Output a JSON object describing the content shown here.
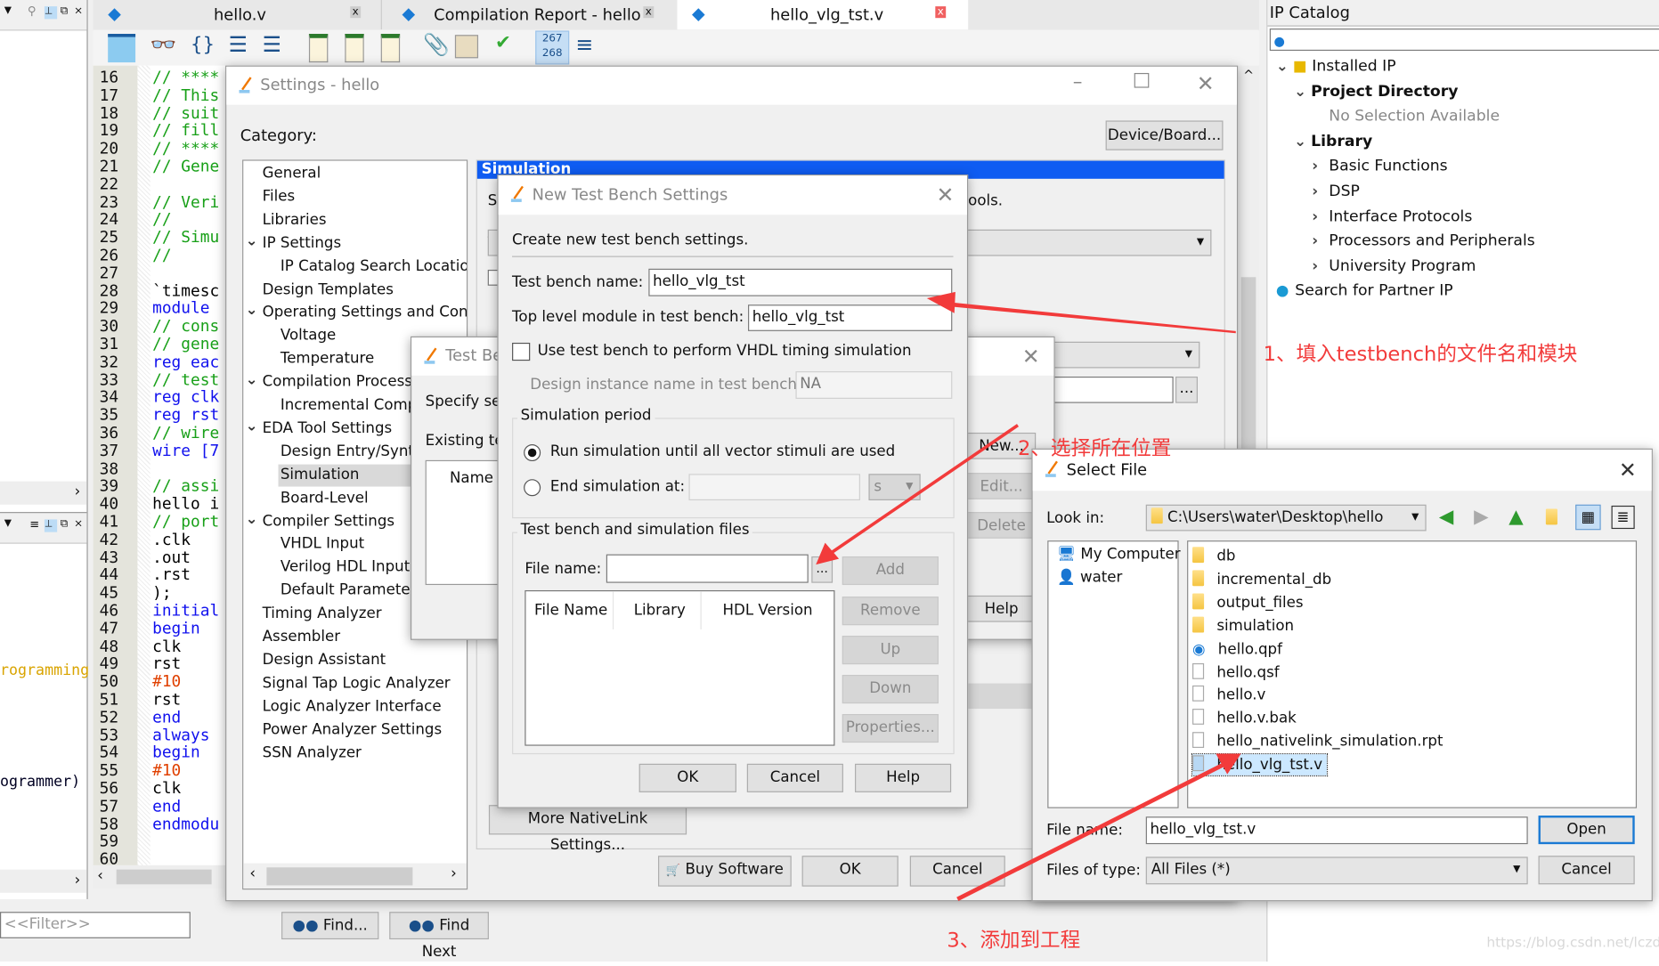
{
  "tabs": [
    {
      "label": "hello.v",
      "active": false
    },
    {
      "label": "Compilation Report - hello",
      "active": false
    },
    {
      "label": "hello_vlg_tst.v",
      "active": true
    }
  ],
  "toolbar": {
    "line_counter_top": "267",
    "line_counter_bottom": "268"
  },
  "left_panel": {
    "text_1": "rogramming",
    "text_2": "ogrammer)",
    "filter_placeholder": "<<Filter>>"
  },
  "editor": {
    "lines": [
      {
        "n": "16",
        "t": "// ****",
        "k": "cm"
      },
      {
        "n": "17",
        "t": "// This",
        "k": "cm"
      },
      {
        "n": "18",
        "t": "// suit",
        "k": "cm"
      },
      {
        "n": "19",
        "t": "// fill",
        "k": "cm"
      },
      {
        "n": "20",
        "t": "// ****",
        "k": "cm"
      },
      {
        "n": "21",
        "t": "// Gene",
        "k": "cm"
      },
      {
        "n": "22",
        "t": "",
        "k": "tx"
      },
      {
        "n": "23",
        "t": "// Veri",
        "k": "cm"
      },
      {
        "n": "24",
        "t": "//",
        "k": "cm"
      },
      {
        "n": "25",
        "t": "// Simu",
        "k": "cm"
      },
      {
        "n": "26",
        "t": "//",
        "k": "cm"
      },
      {
        "n": "27",
        "t": "",
        "k": "tx"
      },
      {
        "n": "28",
        "t": "`timesc",
        "k": "tx"
      },
      {
        "n": "29",
        "t": "module",
        "k": "kw"
      },
      {
        "n": "30",
        "t": "// cons",
        "k": "cm"
      },
      {
        "n": "31",
        "t": "// gene",
        "k": "cm"
      },
      {
        "n": "32",
        "t": "reg eac",
        "k": "kw"
      },
      {
        "n": "33",
        "t": "// test",
        "k": "cm"
      },
      {
        "n": "34",
        "t": "reg clk",
        "k": "kw"
      },
      {
        "n": "35",
        "t": "reg rst",
        "k": "kw"
      },
      {
        "n": "36",
        "t": "// wire",
        "k": "cm"
      },
      {
        "n": "37",
        "t": "wire [7",
        "k": "kw"
      },
      {
        "n": "38",
        "t": "",
        "k": "tx"
      },
      {
        "n": "39",
        "t": "// assi",
        "k": "cm"
      },
      {
        "n": "40",
        "t": "hello i",
        "k": "tx"
      },
      {
        "n": "41",
        "t": "// port",
        "k": "cm"
      },
      {
        "n": "42",
        "t": "   .clk",
        "k": "tx"
      },
      {
        "n": "43",
        "t": "   .out",
        "k": "tx"
      },
      {
        "n": "44",
        "t": "   .rst",
        "k": "tx"
      },
      {
        "n": "45",
        "t": ");",
        "k": "tx"
      },
      {
        "n": "46",
        "t": "initial",
        "k": "kw"
      },
      {
        "n": "47",
        "t": "begin",
        "k": "kw"
      },
      {
        "n": "48",
        "t": "    clk",
        "k": "tx"
      },
      {
        "n": "49",
        "t": "    rst",
        "k": "tx"
      },
      {
        "n": "50",
        "t": "    #10",
        "k": "num"
      },
      {
        "n": "51",
        "t": "    rst",
        "k": "tx"
      },
      {
        "n": "52",
        "t": "end",
        "k": "kw"
      },
      {
        "n": "53",
        "t": "always",
        "k": "kw"
      },
      {
        "n": "54",
        "t": "begin",
        "k": "kw"
      },
      {
        "n": "55",
        "t": "    #10",
        "k": "num"
      },
      {
        "n": "56",
        "t": "    clk",
        "k": "tx"
      },
      {
        "n": "57",
        "t": "end",
        "k": "kw"
      },
      {
        "n": "58",
        "t": "endmodu",
        "k": "kw"
      },
      {
        "n": "59",
        "t": "",
        "k": "tx"
      },
      {
        "n": "60",
        "t": "",
        "k": "tx"
      }
    ]
  },
  "find": {
    "find_label": "Find...",
    "find_next_label": "Find Next"
  },
  "ip_catalog": {
    "title": "IP Catalog",
    "items": [
      {
        "label": "Installed IP",
        "level": 0,
        "exp": "v",
        "bold": false
      },
      {
        "label": "Project Directory",
        "level": 1,
        "exp": "v",
        "bold": true
      },
      {
        "label": "No Selection Available",
        "level": 2,
        "exp": "",
        "bold": false,
        "muted": true
      },
      {
        "label": "Library",
        "level": 1,
        "exp": "v",
        "bold": true
      },
      {
        "label": "Basic Functions",
        "level": 2,
        "exp": ">",
        "bold": false
      },
      {
        "label": "DSP",
        "level": 2,
        "exp": ">",
        "bold": false
      },
      {
        "label": "Interface Protocols",
        "level": 2,
        "exp": ">",
        "bold": false
      },
      {
        "label": "Processors and Peripherals",
        "level": 2,
        "exp": ">",
        "bold": false
      },
      {
        "label": "University Program",
        "level": 2,
        "exp": ">",
        "bold": false
      },
      {
        "label": "Search for Partner IP",
        "level": 0,
        "exp": "",
        "bold": false
      }
    ]
  },
  "settings": {
    "title": "Settings - hello",
    "category_label": "Category:",
    "device_board": "Device/Board...",
    "categories": [
      {
        "label": "General",
        "level": 0,
        "exp": ""
      },
      {
        "label": "Files",
        "level": 0,
        "exp": ""
      },
      {
        "label": "Libraries",
        "level": 0,
        "exp": ""
      },
      {
        "label": "IP Settings",
        "level": 0,
        "exp": "v"
      },
      {
        "label": "IP Catalog Search Locations",
        "level": 1,
        "exp": ""
      },
      {
        "label": "Design Templates",
        "level": 0,
        "exp": ""
      },
      {
        "label": "Operating Settings and Conditions",
        "level": 0,
        "exp": "v"
      },
      {
        "label": "Voltage",
        "level": 1,
        "exp": ""
      },
      {
        "label": "Temperature",
        "level": 1,
        "exp": ""
      },
      {
        "label": "Compilation Process Settings",
        "level": 0,
        "exp": "v"
      },
      {
        "label": "Incremental Compilation",
        "level": 1,
        "exp": ""
      },
      {
        "label": "EDA Tool Settings",
        "level": 0,
        "exp": "v"
      },
      {
        "label": "Design Entry/Synthesis",
        "level": 1,
        "exp": ""
      },
      {
        "label": "Simulation",
        "level": 1,
        "exp": "",
        "selected": true
      },
      {
        "label": "Board-Level",
        "level": 1,
        "exp": ""
      },
      {
        "label": "Compiler Settings",
        "level": 0,
        "exp": "v"
      },
      {
        "label": "VHDL Input",
        "level": 1,
        "exp": ""
      },
      {
        "label": "Verilog HDL Input",
        "level": 1,
        "exp": ""
      },
      {
        "label": "Default Parameters",
        "level": 1,
        "exp": ""
      },
      {
        "label": "Timing Analyzer",
        "level": 0,
        "exp": ""
      },
      {
        "label": "Assembler",
        "level": 0,
        "exp": ""
      },
      {
        "label": "Design Assistant",
        "level": 0,
        "exp": ""
      },
      {
        "label": "Signal Tap Logic Analyzer",
        "level": 0,
        "exp": ""
      },
      {
        "label": "Logic Analyzer Interface",
        "level": 0,
        "exp": ""
      },
      {
        "label": "Power Analyzer Settings",
        "level": 0,
        "exp": ""
      },
      {
        "label": "SSN Analyzer",
        "level": 0,
        "exp": ""
      }
    ],
    "panel_header": "Simulation",
    "panel_text_frag_1": "S",
    "panel_text_frag_2": "ools.",
    "panel_text_frag_3": "T",
    "more_nativelink": "More NativeLink Settings...",
    "buy_software": "Buy Software",
    "ok": "OK",
    "cancel": "Cancel"
  },
  "testbench_dialog": {
    "title": "Test Be",
    "specify": "Specify se",
    "existing": "Existing te",
    "name_header": "Name",
    "new": "New...",
    "edit": "Edit...",
    "delete": "Delete",
    "help": "Help"
  },
  "new_tb": {
    "title": "New Test Bench Settings",
    "intro": "Create new test bench settings.",
    "tb_name_label": "Test bench name:",
    "tb_name_value": "hello_vlg_tst",
    "top_module_label": "Top level module in test bench:",
    "top_module_value": "hello_vlg_tst",
    "vhdl_timing_label": "Use test bench to perform VHDL timing simulation",
    "vhdl_timing_checked": false,
    "instance_label": "Design instance name in test bench:",
    "instance_value": "NA",
    "sim_period_group": "Simulation period",
    "radio_run_all": "Run simulation until all vector stimuli are used",
    "radio_end_at": "End simulation at:",
    "end_at_unit": "s",
    "files_group": "Test bench and simulation files",
    "file_name_label": "File name:",
    "file_name_value": "",
    "browse": "...",
    "columns": [
      "File Name",
      "Library",
      "HDL Version"
    ],
    "add": "Add",
    "remove": "Remove",
    "up": "Up",
    "down": "Down",
    "properties": "Properties...",
    "ok": "OK",
    "cancel": "Cancel",
    "help": "Help"
  },
  "select_file": {
    "title": "Select File",
    "look_in_label": "Look in:",
    "look_in_value": "C:\\Users\\water\\Desktop\\hello",
    "places": [
      "My Computer",
      "water"
    ],
    "files": [
      {
        "name": "db",
        "type": "folder"
      },
      {
        "name": "incremental_db",
        "type": "folder"
      },
      {
        "name": "output_files",
        "type": "folder"
      },
      {
        "name": "simulation",
        "type": "folder"
      },
      {
        "name": "hello.qpf",
        "type": "project"
      },
      {
        "name": "hello.qsf",
        "type": "file"
      },
      {
        "name": "hello.v",
        "type": "file"
      },
      {
        "name": "hello.v.bak",
        "type": "file"
      },
      {
        "name": "hello_nativelink_simulation.rpt",
        "type": "report"
      },
      {
        "name": "hello_vlg_tst.v",
        "type": "file",
        "selected": true
      }
    ],
    "file_name_label": "File name:",
    "file_name_value": "hello_vlg_tst.v",
    "type_label": "Files of type:",
    "type_value": "All Files (*)",
    "open": "Open",
    "cancel": "Cancel"
  },
  "annotations": {
    "step1": "1、填入testbench的文件名和模块",
    "step2": "2、选择所在位置",
    "step3": "3、添加到工程",
    "color": "#f23b3b"
  },
  "watermark": "https://blog.csdn.net/lczdk"
}
